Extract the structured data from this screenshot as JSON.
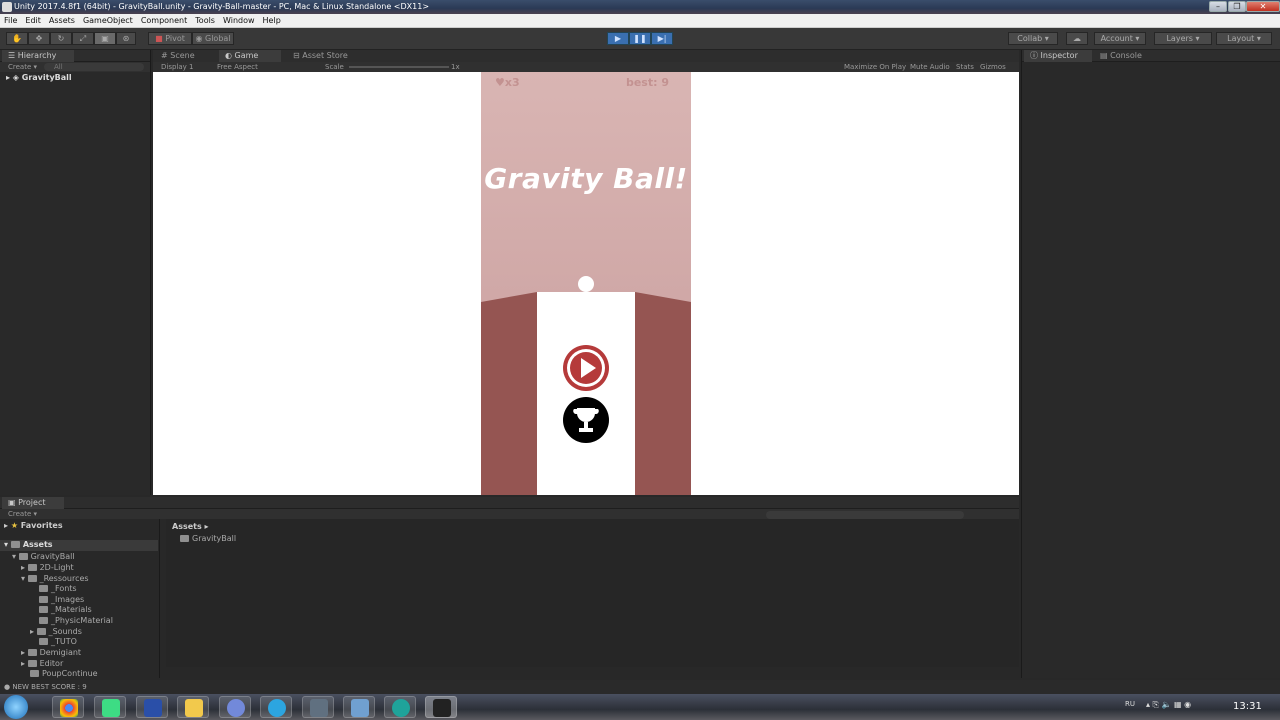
{
  "window": {
    "title": "Unity 2017.4.8f1 (64bit) - GravityBall.unity - Gravity-Ball-master - PC, Mac & Linux Standalone <DX11>"
  },
  "menu": [
    "File",
    "Edit",
    "Assets",
    "GameObject",
    "Component",
    "Tools",
    "Window",
    "Help"
  ],
  "toolbar": {
    "pivot": "Pivot",
    "global": "Global",
    "collab": "Collab",
    "account": "Account",
    "layers": "Layers",
    "layout": "Layout"
  },
  "hierarchy": {
    "tab": "Hierarchy",
    "create": "Create",
    "search_placeholder": "All",
    "scene": "GravityBall"
  },
  "center_tabs": {
    "scene": "Scene",
    "game": "Game",
    "asset_store": "Asset Store"
  },
  "game_bar": {
    "display": "Display 1",
    "aspect": "Free Aspect",
    "scale_label": "Scale",
    "scale_value": "1x",
    "maximize": "Maximize On Play",
    "mute": "Mute Audio",
    "stats": "Stats",
    "gizmos": "Gizmos"
  },
  "game": {
    "lives": "x3",
    "best": "best: 9",
    "title": "Gravity Ball!"
  },
  "right_tabs": {
    "inspector": "Inspector",
    "console": "Console"
  },
  "project": {
    "tab": "Project",
    "create": "Create",
    "favorites": "Favorites",
    "assets_label": "Assets",
    "breadcrumb": "Assets",
    "content_folder": "GravityBall",
    "tree": [
      {
        "label": "Assets"
      },
      {
        "label": "GravityBall"
      },
      {
        "label": "2D-Light"
      },
      {
        "label": "_Ressources"
      },
      {
        "label": "_Fonts"
      },
      {
        "label": "_Images"
      },
      {
        "label": "_Materials"
      },
      {
        "label": "_PhysicMaterial"
      },
      {
        "label": "_Sounds"
      },
      {
        "label": "_TUTO"
      },
      {
        "label": "Demigiant"
      },
      {
        "label": "Editor"
      },
      {
        "label": "PoupContinue"
      }
    ]
  },
  "status": {
    "message": "NEW BEST SCORE : 9"
  },
  "taskbar": {
    "lang": "RU",
    "time": "13:31"
  },
  "colors": {
    "game_bg_top": "#d9b5b3",
    "wall": "#955552",
    "play": "#b53a3a",
    "unity_dark": "#282828"
  }
}
